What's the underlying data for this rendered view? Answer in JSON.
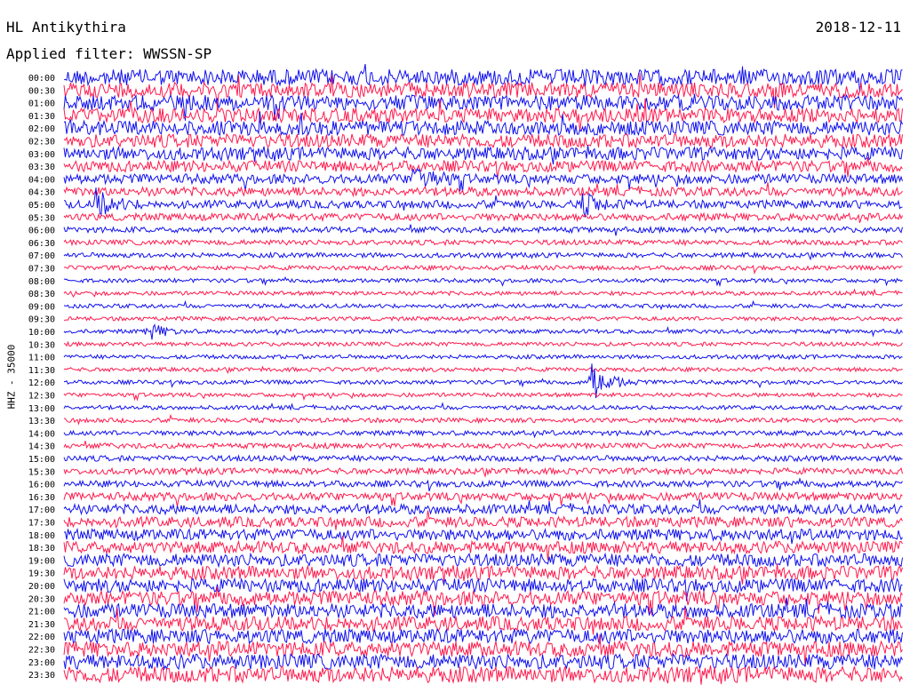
{
  "header": {
    "station": "HL Antikythira",
    "filter": "Applied filter: WWSSN-SP",
    "date": "2018-12-11",
    "channel_label": "HHZ - 35000"
  },
  "chart_data": {
    "type": "line",
    "title": "HL Antikythira",
    "subtitle": "Applied filter: WWSSN-SP",
    "ylabel": "HHZ - 35000",
    "date": "2018-12-11",
    "grid": false,
    "trace_colors": [
      "#1010ee",
      "#ff1a4d"
    ],
    "row_labels": [
      "00:00",
      "00:30",
      "01:00",
      "01:30",
      "02:00",
      "02:30",
      "03:00",
      "03:30",
      "04:00",
      "04:30",
      "05:00",
      "05:30",
      "06:00",
      "06:30",
      "07:00",
      "07:30",
      "08:00",
      "08:30",
      "09:00",
      "09:30",
      "10:00",
      "10:30",
      "11:00",
      "11:30",
      "12:00",
      "12:30",
      "13:00",
      "13:30",
      "14:00",
      "14:30",
      "15:00",
      "15:30",
      "16:00",
      "16:30",
      "17:00",
      "17:30",
      "18:00",
      "18:30",
      "19:00",
      "19:30",
      "20:00",
      "20:30",
      "21:00",
      "21:30",
      "22:00",
      "22:30",
      "23:00",
      "23:30"
    ],
    "noise_amplitude": [
      1.0,
      0.95,
      0.95,
      0.9,
      0.9,
      0.85,
      0.8,
      0.7,
      0.6,
      0.55,
      0.5,
      0.45,
      0.35,
      0.32,
      0.3,
      0.28,
      0.25,
      0.25,
      0.25,
      0.25,
      0.25,
      0.25,
      0.25,
      0.25,
      0.25,
      0.25,
      0.25,
      0.28,
      0.3,
      0.32,
      0.35,
      0.38,
      0.4,
      0.5,
      0.6,
      0.65,
      0.7,
      0.75,
      0.8,
      0.85,
      0.85,
      0.9,
      0.9,
      0.9,
      0.9,
      0.95,
      0.95,
      1.0
    ],
    "events": [
      {
        "row": "04:00",
        "position": 0.42,
        "amplitude": 1.4
      },
      {
        "row": "05:00",
        "position": 0.04,
        "amplitude": 1.2
      },
      {
        "row": "05:00",
        "position": 0.62,
        "amplitude": 0.9
      },
      {
        "row": "10:00",
        "position": 0.1,
        "amplitude": 0.8
      },
      {
        "row": "12:00",
        "position": 0.63,
        "amplitude": 1.8
      }
    ]
  }
}
